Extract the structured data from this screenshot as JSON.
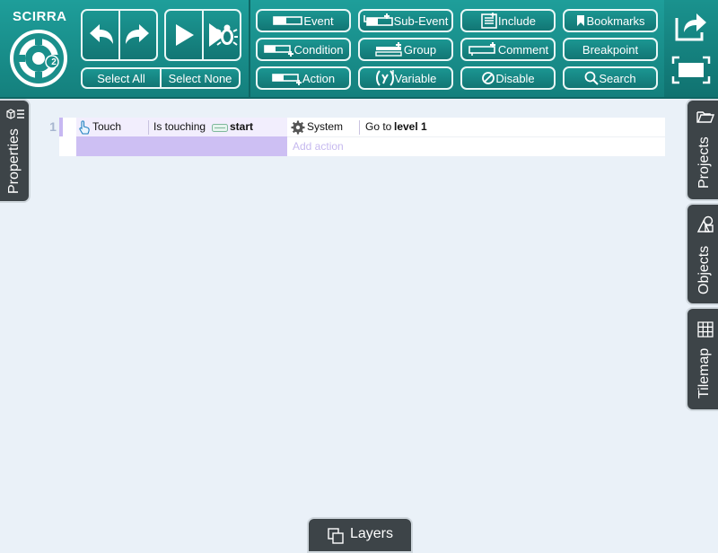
{
  "brand": {
    "name": "SCIRRA",
    "logo_badge": "2"
  },
  "toolbar": {
    "select_all": "Select All",
    "select_none": "Select None",
    "event": "Event",
    "sub_event": "Sub-Event",
    "include": "Include",
    "bookmarks": "Bookmarks",
    "condition": "Condition",
    "group": "Group",
    "comment": "Comment",
    "breakpoint": "Breakpoint",
    "action": "Action",
    "variable": "Variable",
    "disable": "Disable",
    "search": "Search"
  },
  "icons": {
    "undo": "undo-icon",
    "redo": "redo-icon",
    "play": "play-icon",
    "debug": "bug-icon",
    "share": "share-icon",
    "fullscreen": "fullscreen-icon"
  },
  "sidebar_left": {
    "properties": "Properties"
  },
  "sidebar_right": {
    "projects": "Projects",
    "objects": "Objects",
    "tilemap": "Tilemap"
  },
  "event_sheet": {
    "rows": [
      {
        "number": "1",
        "condition": {
          "object": "Touch",
          "text": "Is touching",
          "target": "start"
        },
        "action": {
          "object": "System",
          "text": "Go to",
          "target": "level 1"
        },
        "add_action": "Add action"
      }
    ]
  },
  "bottom": {
    "layers": "Layers"
  },
  "colors": {
    "toolbar": "#1a8f8b",
    "tab": "#3d4448",
    "background": "#eaf1f8",
    "condition_accent": "#c7b8f2"
  }
}
